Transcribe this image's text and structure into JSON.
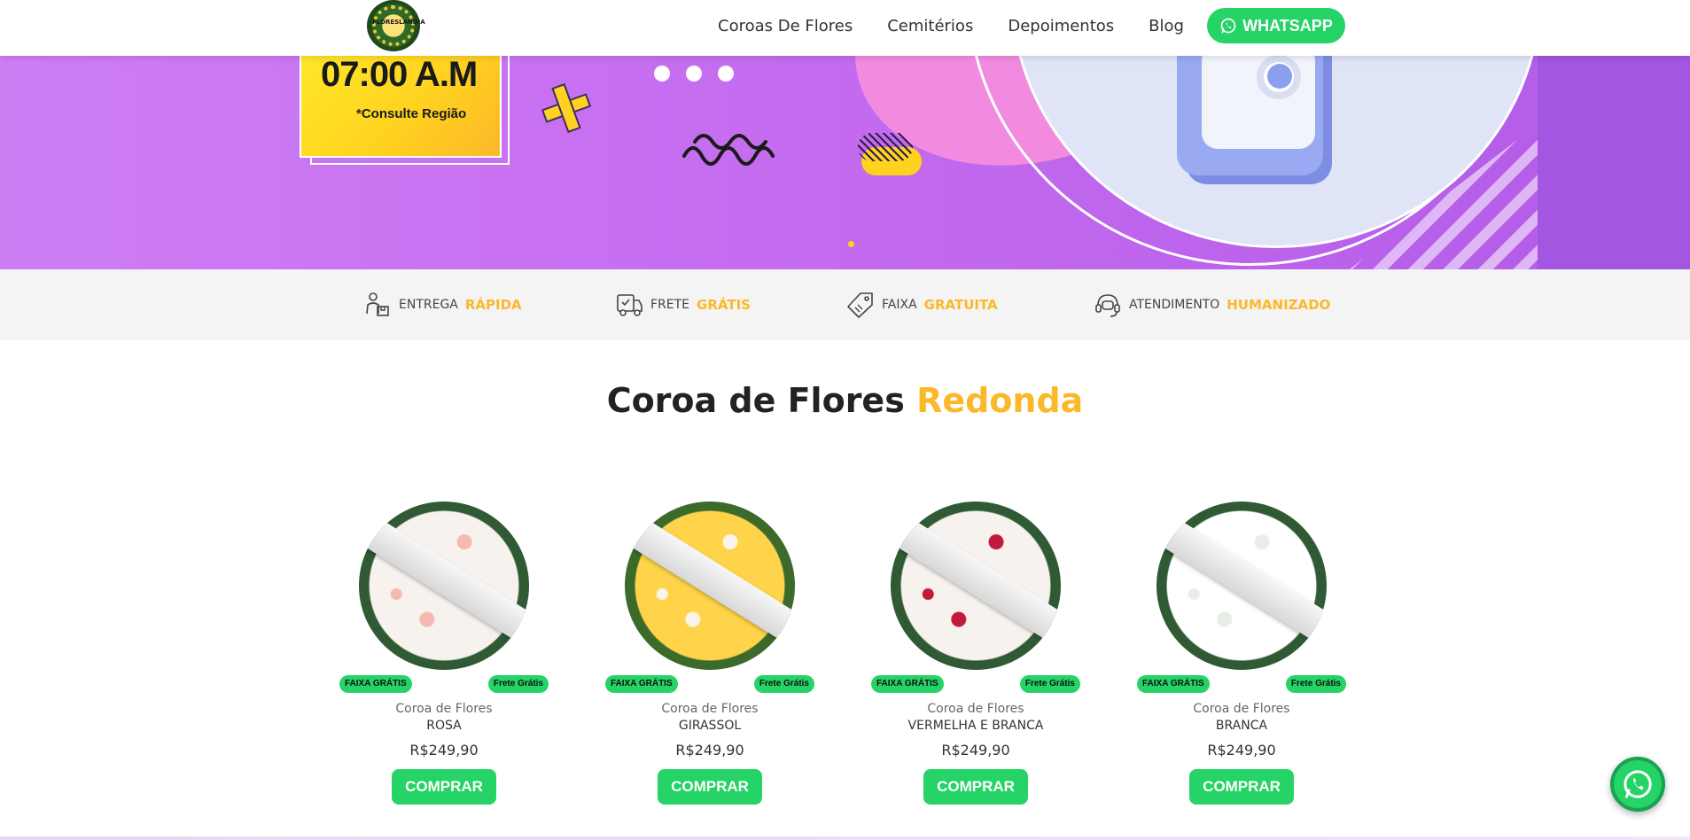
{
  "hero": {
    "hour": "07:00 A.M",
    "hour_note": "*Consulte Região",
    "colors": {
      "background": "#c56cf0",
      "accent": "#ffd21f"
    }
  },
  "header": {
    "logo_text": "FLORESLANDIA",
    "nav": [
      "Coroas De Flores",
      "Cemitérios",
      "Depoimentos",
      "Blog"
    ],
    "whatsapp_label": "WHATSAPP"
  },
  "features": [
    {
      "label": "ENTREGA",
      "highlight": "RÁPIDA",
      "icon": "delivery-person-icon"
    },
    {
      "label": "FRETE",
      "highlight": "GRÁTIS",
      "icon": "truck-icon"
    },
    {
      "label": "FAIXA",
      "highlight": "GRATUITA",
      "icon": "tag-icon"
    },
    {
      "label": "ATENDIMENTO",
      "highlight": "HUMANIZADO",
      "icon": "headset-icon"
    }
  ],
  "section": {
    "title": "Coroa de Flores",
    "highlight": "Redonda"
  },
  "products": [
    {
      "category": "Coroa de Flores",
      "name": "ROSA",
      "price": "R$249,90",
      "badge_left": "FAIXA GRÁTIS",
      "badge_right": "Frete Grátis",
      "button": "COMPRAR",
      "palette": [
        "#2f5a34",
        "#f7f2ee",
        "#f5b9b0"
      ]
    },
    {
      "category": "Coroa de Flores",
      "name": "GIRASSOL",
      "price": "R$249,90",
      "badge_left": "FAIXA GRÁTIS",
      "badge_right": "Frete Grátis",
      "button": "COMPRAR",
      "palette": [
        "#3c6a2b",
        "#ffd44a",
        "#f9f5ea"
      ]
    },
    {
      "category": "Coroa de Flores",
      "name": "VERMELHA E BRANCA",
      "price": "R$249,90",
      "badge_left": "FAIXA GRÁTIS",
      "badge_right": "Frete Grátis",
      "button": "COMPRAR",
      "palette": [
        "#2f5a34",
        "#f7f2ee",
        "#c21a3a"
      ]
    },
    {
      "category": "Coroa de Flores",
      "name": "BRANCA",
      "price": "R$249,90",
      "badge_left": "FAIXA GRÁTIS",
      "badge_right": "Frete Grátis",
      "button": "COMPRAR",
      "palette": [
        "#2f5a34",
        "#ffffff",
        "#e8ede6"
      ]
    }
  ],
  "colors": {
    "brand_green": "#25d366",
    "highlight_yellow": "#fbb829"
  }
}
